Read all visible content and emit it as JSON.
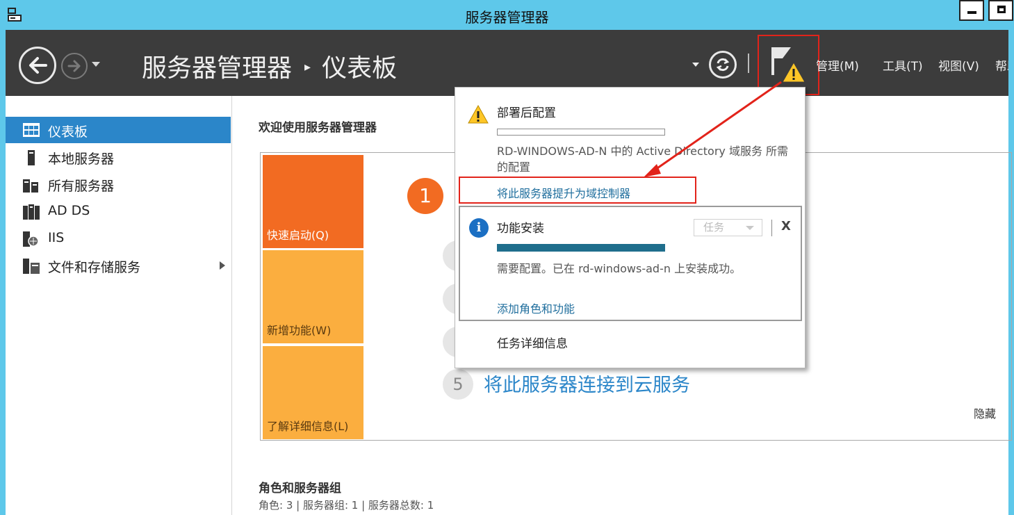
{
  "window": {
    "title": "服务器管理器"
  },
  "header": {
    "breadcrumb_root": "服务器管理器",
    "breadcrumb_separator": "▸",
    "breadcrumb_current": "仪表板",
    "menus": {
      "manage": "管理(M)",
      "tools": "工具(T)",
      "view": "视图(V)",
      "help": "帮助(H)"
    }
  },
  "sidebar": {
    "items": [
      {
        "label": "仪表板",
        "icon": "dashboard-icon",
        "active": true
      },
      {
        "label": "本地服务器",
        "icon": "server-icon"
      },
      {
        "label": "所有服务器",
        "icon": "servers-icon"
      },
      {
        "label": "AD DS",
        "icon": "ad-ds-icon"
      },
      {
        "label": "IIS",
        "icon": "iis-icon"
      },
      {
        "label": "文件和存储服务",
        "icon": "storage-icon",
        "expandable": true
      }
    ]
  },
  "main": {
    "welcome_title": "欢迎使用服务器管理器",
    "tiles": {
      "quick_start": "快速启动(Q)",
      "whats_new": "新增功能(W)",
      "learn_more": "了解详细信息(L)"
    },
    "step_badge": "1",
    "step_5_number": "5",
    "step_5_text": "将此服务器连接到云服务",
    "hide_label": "隐藏",
    "roles_title": "角色和服务器组",
    "roles_summary": "角色: 3 | 服务器组: 1 | 服务器总数: 1"
  },
  "notifications": {
    "post_deploy": {
      "title": "部署后配置",
      "description": "RD-WINDOWS-AD-N 中的 Active Directory 域服务 所需的配置",
      "link": "将此服务器提升为域控制器"
    },
    "feature_install": {
      "title": "功能安装",
      "task_dropdown": "任务",
      "close": "X",
      "description": "需要配置。已在 rd-windows-ad-n 上安装成功。",
      "link": "添加角色和功能",
      "progress": 1.0
    },
    "task_details": "任务详细信息"
  },
  "colors": {
    "title_bar": "#5ec8ea",
    "header_bg": "#3c3c3c",
    "active_item": "#2b86c9",
    "tile_orange": "#f26b22",
    "tile_amber": "#fbae3f",
    "link": "#1f6e9d",
    "annotation_red": "#e2231a"
  }
}
